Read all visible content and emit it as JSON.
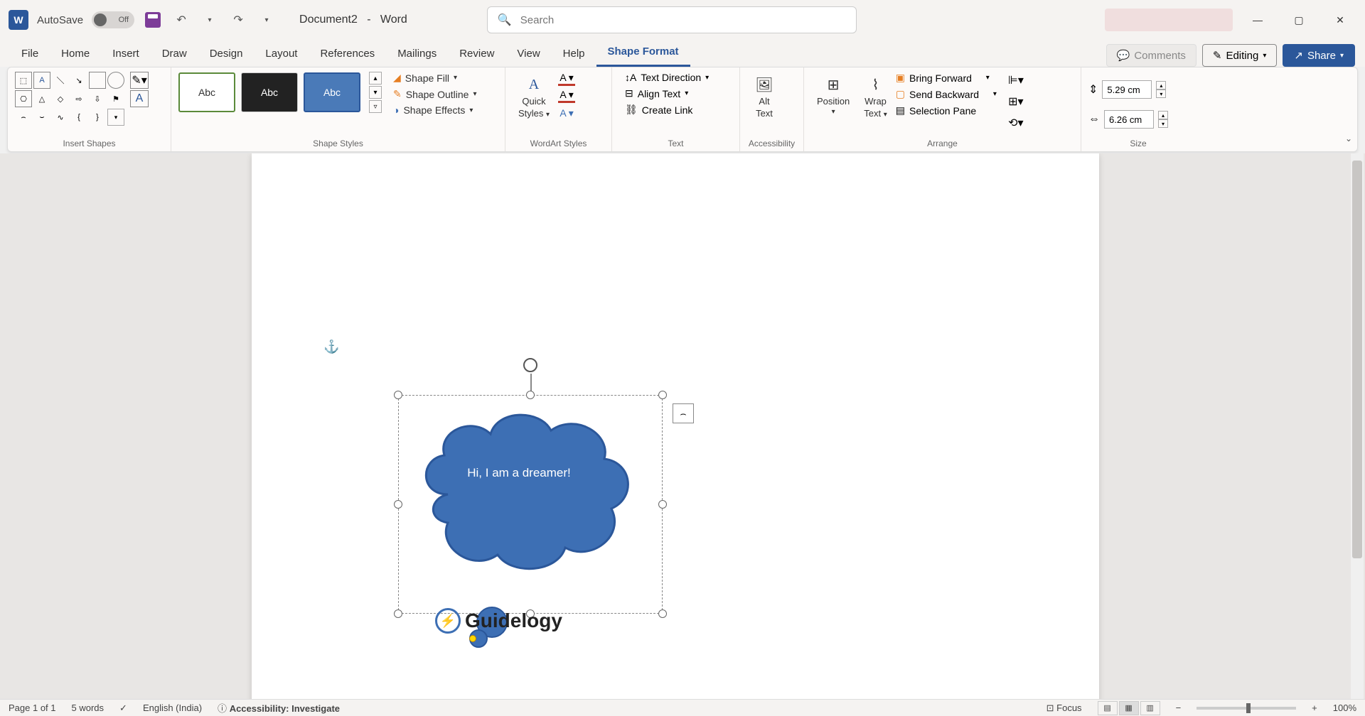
{
  "title": {
    "autosave_label": "AutoSave",
    "autosave_state": "Off",
    "document": "Document2",
    "separator": "-",
    "app": "Word",
    "search_placeholder": "Search"
  },
  "tabs": {
    "file": "File",
    "home": "Home",
    "insert": "Insert",
    "draw": "Draw",
    "design": "Design",
    "layout": "Layout",
    "references": "References",
    "mailings": "Mailings",
    "review": "Review",
    "view": "View",
    "help": "Help",
    "shape_format": "Shape Format"
  },
  "top_actions": {
    "comments": "Comments",
    "editing": "Editing",
    "share": "Share"
  },
  "ribbon": {
    "insert_shapes": {
      "label": "Insert Shapes"
    },
    "shape_styles": {
      "label": "Shape Styles",
      "swatch_text": "Abc",
      "fill": "Shape Fill",
      "outline": "Shape Outline",
      "effects": "Shape Effects"
    },
    "wordart": {
      "label": "WordArt Styles",
      "quick": "Quick",
      "styles": "Styles"
    },
    "text": {
      "label": "Text",
      "direction": "Text Direction",
      "align": "Align Text",
      "create_link": "Create Link"
    },
    "accessibility": {
      "label": "Accessibility",
      "alt": "Alt",
      "text": "Text"
    },
    "arrange": {
      "label": "Arrange",
      "position": "Position",
      "wrap": "Wrap",
      "wrap2": "Text",
      "bring_forward": "Bring Forward",
      "send_backward": "Send Backward",
      "selection_pane": "Selection Pane"
    },
    "size": {
      "label": "Size",
      "height": "5.29 cm",
      "width": "6.26 cm"
    }
  },
  "canvas": {
    "shape_text": "Hi, I am a dreamer!",
    "watermark": "Guidelogy"
  },
  "status": {
    "page": "Page 1 of 1",
    "words": "5 words",
    "language": "English (India)",
    "accessibility": "Accessibility: Investigate",
    "focus": "Focus",
    "zoom": "100%"
  }
}
